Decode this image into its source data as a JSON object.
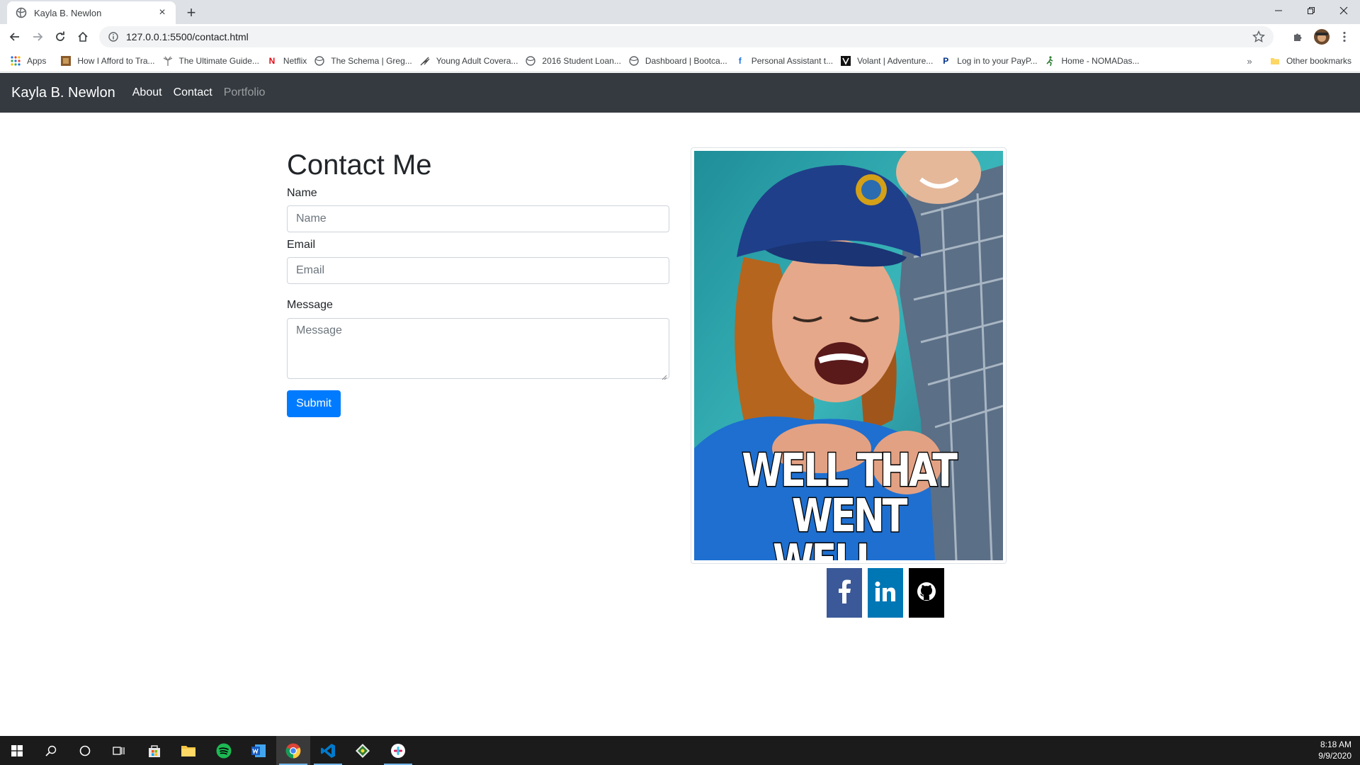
{
  "browser": {
    "tab_title": "Kayla B. Newlon",
    "tab_close": "×",
    "new_tab": "+",
    "url": "127.0.0.1:5500/contact.html",
    "window_controls": {
      "minimize": "—",
      "restore": "❐",
      "close": "✕"
    }
  },
  "bookmarks": {
    "apps_label": "Apps",
    "items": [
      {
        "label": "How I Afford to Tra...",
        "icon": "photo-favicon"
      },
      {
        "label": "The Ultimate Guide...",
        "icon": "palm-favicon"
      },
      {
        "label": "Netflix",
        "icon": "netflix-favicon"
      },
      {
        "label": "The Schema | Greg...",
        "icon": "globe-favicon"
      },
      {
        "label": "Young Adult Covera...",
        "icon": "feather-favicon"
      },
      {
        "label": "2016 Student Loan...",
        "icon": "globe-favicon"
      },
      {
        "label": "Dashboard | Bootca...",
        "icon": "globe-favicon"
      },
      {
        "label": "Personal Assistant t...",
        "icon": "f-favicon"
      },
      {
        "label": "Volant | Adventure...",
        "icon": "v-favicon"
      },
      {
        "label": "Log in to your PayP...",
        "icon": "paypal-favicon"
      },
      {
        "label": "Home - NOMADas...",
        "icon": "runner-favicon"
      }
    ],
    "more": "»",
    "other_label": "Other bookmarks"
  },
  "site_nav": {
    "brand": "Kayla B. Newlon",
    "links": [
      {
        "label": "About",
        "state": "active"
      },
      {
        "label": "Contact",
        "state": "active"
      },
      {
        "label": "Portfolio",
        "state": "muted"
      }
    ]
  },
  "contact_form": {
    "title": "Contact Me",
    "name_label": "Name",
    "name_placeholder": "Name",
    "email_label": "Email",
    "email_placeholder": "Email",
    "message_label": "Message",
    "message_placeholder": "Message",
    "submit_label": "Submit"
  },
  "photo": {
    "caption_line1": "WELL THAT",
    "caption_line2": "WENT WELL...."
  },
  "socials": [
    {
      "name": "facebook",
      "color": "#3b5998"
    },
    {
      "name": "linkedin",
      "color": "#0077b5"
    },
    {
      "name": "github",
      "color": "#000000"
    }
  ],
  "taskbar": {
    "time": "8:18 AM",
    "date": "9/9/2020"
  },
  "colors": {
    "nav_bg": "#343a40",
    "primary": "#007bff"
  }
}
